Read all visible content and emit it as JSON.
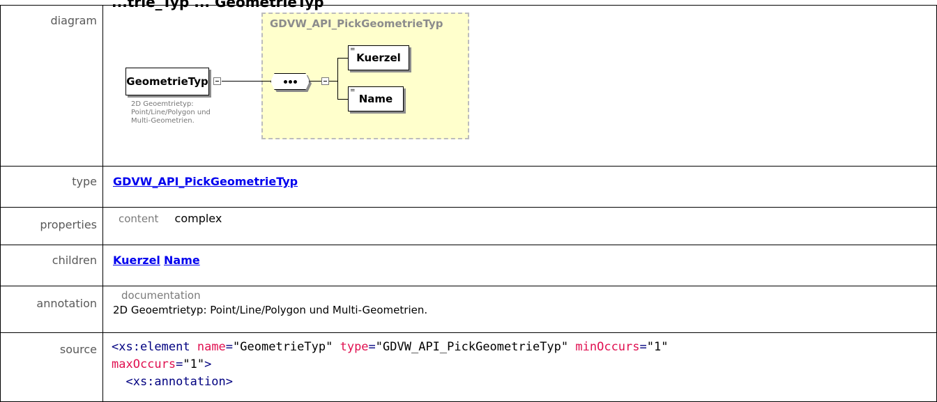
{
  "header_cut": "...trie_Typ ... GeometrieTyp",
  "labels": {
    "diagram": "diagram",
    "type": "type",
    "properties": "properties",
    "children": "children",
    "annotation": "annotation",
    "source": "source"
  },
  "diagram": {
    "group_title": "GDVW_API_PickGeometrieTyp",
    "main_element": "GeometrieTyp",
    "doc_note": "2D Geoemtrietyp:\nPoint/Line/Polygon und\nMulti-Geometrien.",
    "children": [
      "Kuerzel",
      "Name"
    ]
  },
  "type_value": "GDVW_API_PickGeometrieTyp",
  "properties": {
    "key": "content",
    "value": "complex"
  },
  "children": [
    "Kuerzel",
    "Name"
  ],
  "annotation": {
    "title": "documentation",
    "text": "2D Geoemtrietyp: Point/Line/Polygon und Multi-Geometrien."
  },
  "source": {
    "line1_tag": "<xs:element",
    "attr_name": "name",
    "val_name": "\"GeometrieTyp\"",
    "attr_type": "type",
    "val_type": "\"GDVW_API_PickGeometrieTyp\"",
    "attr_min": "minOccurs",
    "val_min": "\"1\"",
    "attr_max": "maxOccurs",
    "val_max": "\"1\"",
    "close": ">",
    "line3": "  <xs:annotation>",
    "eq": "="
  }
}
